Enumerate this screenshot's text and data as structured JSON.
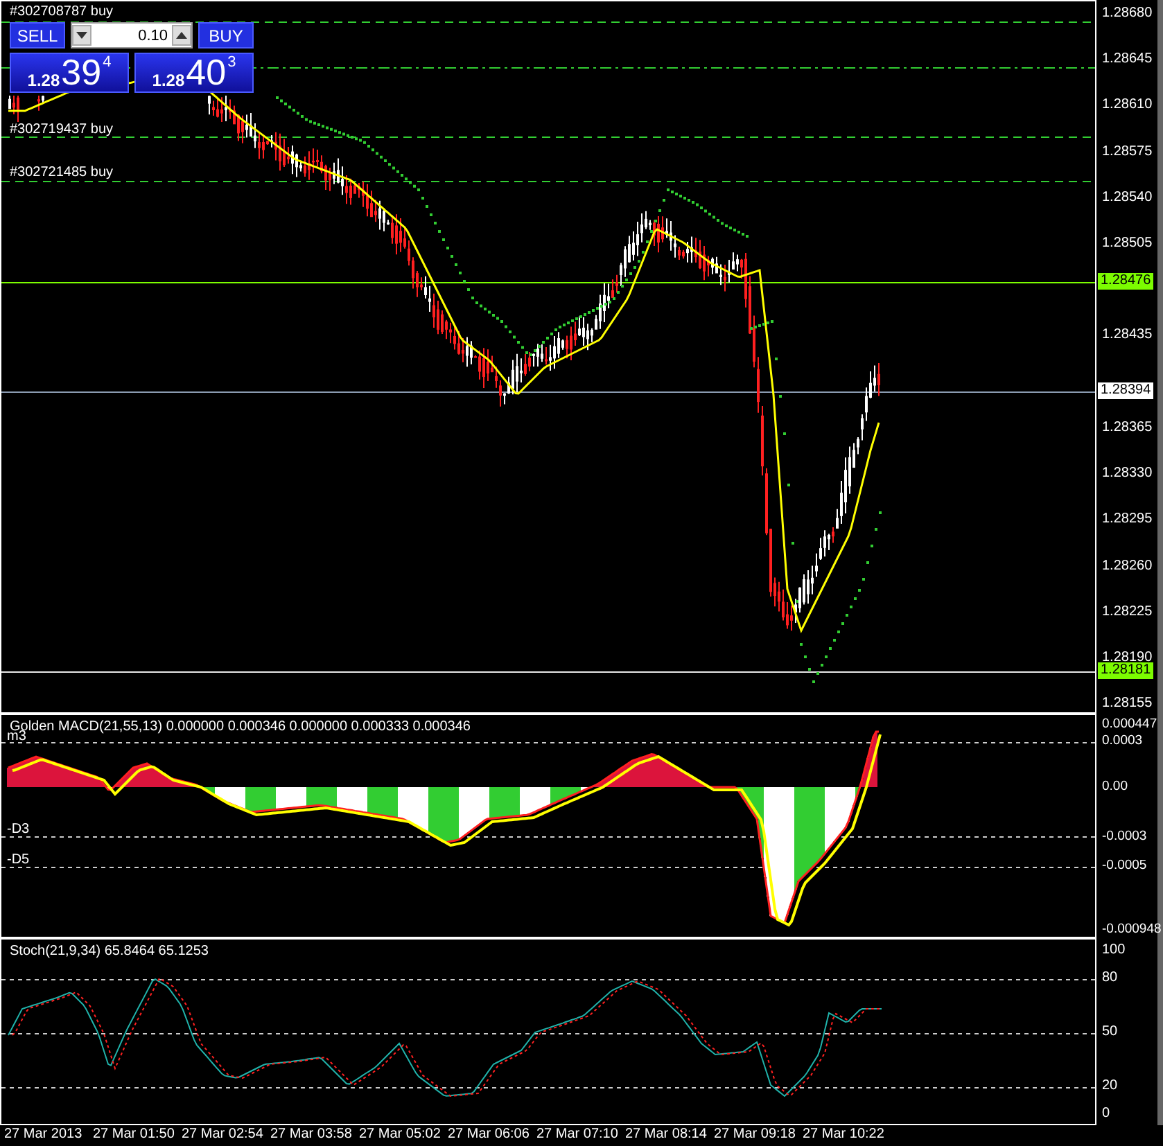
{
  "orders": [
    {
      "label": "#302708787 buy"
    },
    {
      "label": "#302719437 buy"
    },
    {
      "label": "#302721485 buy"
    }
  ],
  "trade_panel": {
    "sell_label": "SELL",
    "buy_label": "BUY",
    "volume": "0.10",
    "sell_price": {
      "prefix": "1.28",
      "big": "39",
      "small": "4"
    },
    "buy_price": {
      "prefix": "1.28",
      "big": "40",
      "small": "3"
    }
  },
  "price_axis": [
    "1.28680",
    "1.28645",
    "1.28610",
    "1.28575",
    "1.28540",
    "1.28505",
    "1.28435",
    "1.28365",
    "1.28330",
    "1.28295",
    "1.28260",
    "1.28225",
    "1.28190",
    "1.28155"
  ],
  "price_markers": [
    {
      "value": "1.28476",
      "kind": "highlight"
    },
    {
      "value": "1.28394",
      "kind": "plain"
    },
    {
      "value": "1.28181",
      "kind": "highlight"
    }
  ],
  "macd": {
    "title": "Golden MACD(21,55,13) 0.000000 0.000346 0.000000 0.000333 0.000346",
    "labels": [
      "m3",
      "-D3",
      "-D5"
    ],
    "axis": [
      "0.000447",
      "0.0003",
      "0.00",
      "-0.0003",
      "-0.0005",
      "-0.000948"
    ]
  },
  "stoch": {
    "title": "Stoch(21,9,34) 65.8464 65.1253",
    "axis": [
      "100",
      "80",
      "50",
      "20",
      "0"
    ]
  },
  "time_axis": [
    "27 Mar 2013",
    "27 Mar 01:50",
    "27 Mar 02:54",
    "27 Mar 03:58",
    "27 Mar 05:02",
    "27 Mar 06:06",
    "27 Mar 07:10",
    "27 Mar 08:14",
    "27 Mar 09:18",
    "27 Mar 10:22"
  ]
}
